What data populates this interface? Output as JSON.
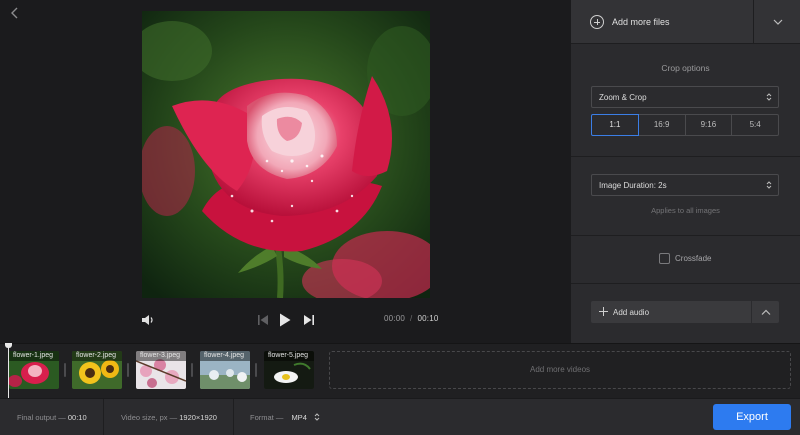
{
  "player": {
    "current_time": "00:00",
    "separator": "/",
    "total_time": "00:10"
  },
  "right_panel": {
    "add_files_label": "Add more files",
    "crop": {
      "title": "Crop options",
      "mode_value": "Zoom & Crop",
      "ratios": [
        "1:1",
        "16:9",
        "9:16",
        "5:4"
      ],
      "active_ratio": "1:1"
    },
    "duration": {
      "value": "Image Duration: 2s",
      "note": "Applies to all images"
    },
    "crossfade": {
      "label": "Crossfade",
      "checked": false
    },
    "audio": {
      "add_label": "Add audio"
    }
  },
  "timeline": {
    "clips": [
      {
        "name": "flower-1.jpeg"
      },
      {
        "name": "flower-2.jpeg"
      },
      {
        "name": "flower-3.jpeg"
      },
      {
        "name": "flower-4.jpeg"
      },
      {
        "name": "flower-5.jpeg"
      }
    ],
    "add_more_label": "Add more videos"
  },
  "bottom_bar": {
    "final_output_label": "Final output —",
    "final_output_value": "00:10",
    "video_size_label": "Video size, px —",
    "video_size_value": "1920×1920",
    "format_label": "Format —",
    "format_value": "MP4",
    "export_label": "Export"
  },
  "colors": {
    "accent": "#2d7bf0",
    "active_ratio_border": "#3b7ee6",
    "panel_bg": "#2b2b2e",
    "app_bg": "#1b1b1d"
  },
  "icons": {
    "back": "chevron-left-icon",
    "add_files": "plus-circle-icon",
    "dropdown": "chevron-down-icon",
    "volume": "volume-icon",
    "prev": "skip-previous-icon",
    "play": "play-icon",
    "next": "skip-next-icon",
    "audio_add": "plus-icon",
    "audio_toggle": "chevron-up-icon"
  }
}
